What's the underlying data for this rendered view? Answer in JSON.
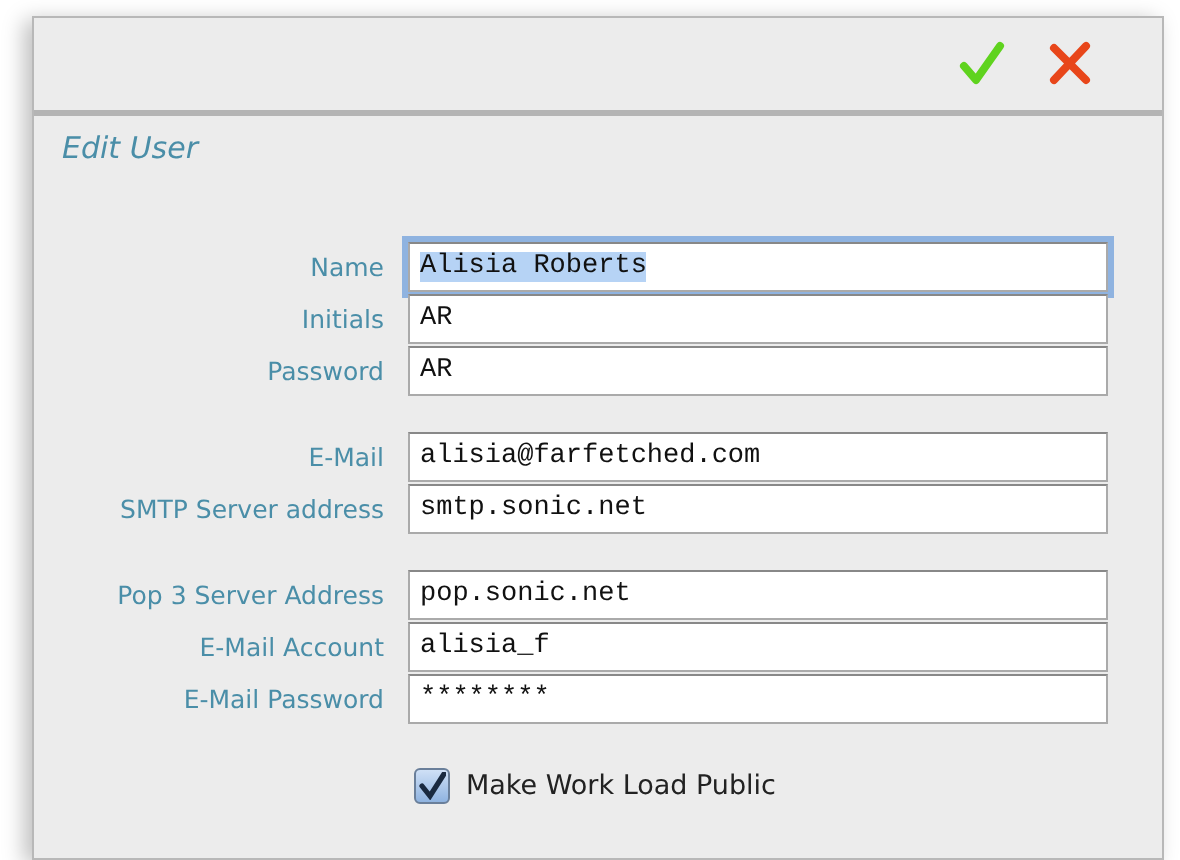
{
  "window": {
    "title": "Edit User"
  },
  "field_groups": [
    {
      "fields": [
        {
          "label": "Name",
          "value": "Alisia Roberts",
          "focused": true
        },
        {
          "label": "Initials",
          "value": "AR",
          "focused": false
        },
        {
          "label": "Password",
          "value": "AR",
          "focused": false
        }
      ]
    },
    {
      "fields": [
        {
          "label": "E-Mail",
          "value": "alisia@farfetched.com",
          "focused": false
        },
        {
          "label": "SMTP Server address",
          "value": "smtp.sonic.net",
          "focused": false
        }
      ]
    },
    {
      "fields": [
        {
          "label": "Pop 3 Server Address",
          "value": "pop.sonic.net",
          "focused": false
        },
        {
          "label": "E-Mail Account",
          "value": "alisia_f",
          "focused": false
        },
        {
          "label": "E-Mail Password",
          "value": "********",
          "focused": false
        }
      ]
    }
  ],
  "checkbox": {
    "label": "Make Work Load Public",
    "checked": true
  }
}
